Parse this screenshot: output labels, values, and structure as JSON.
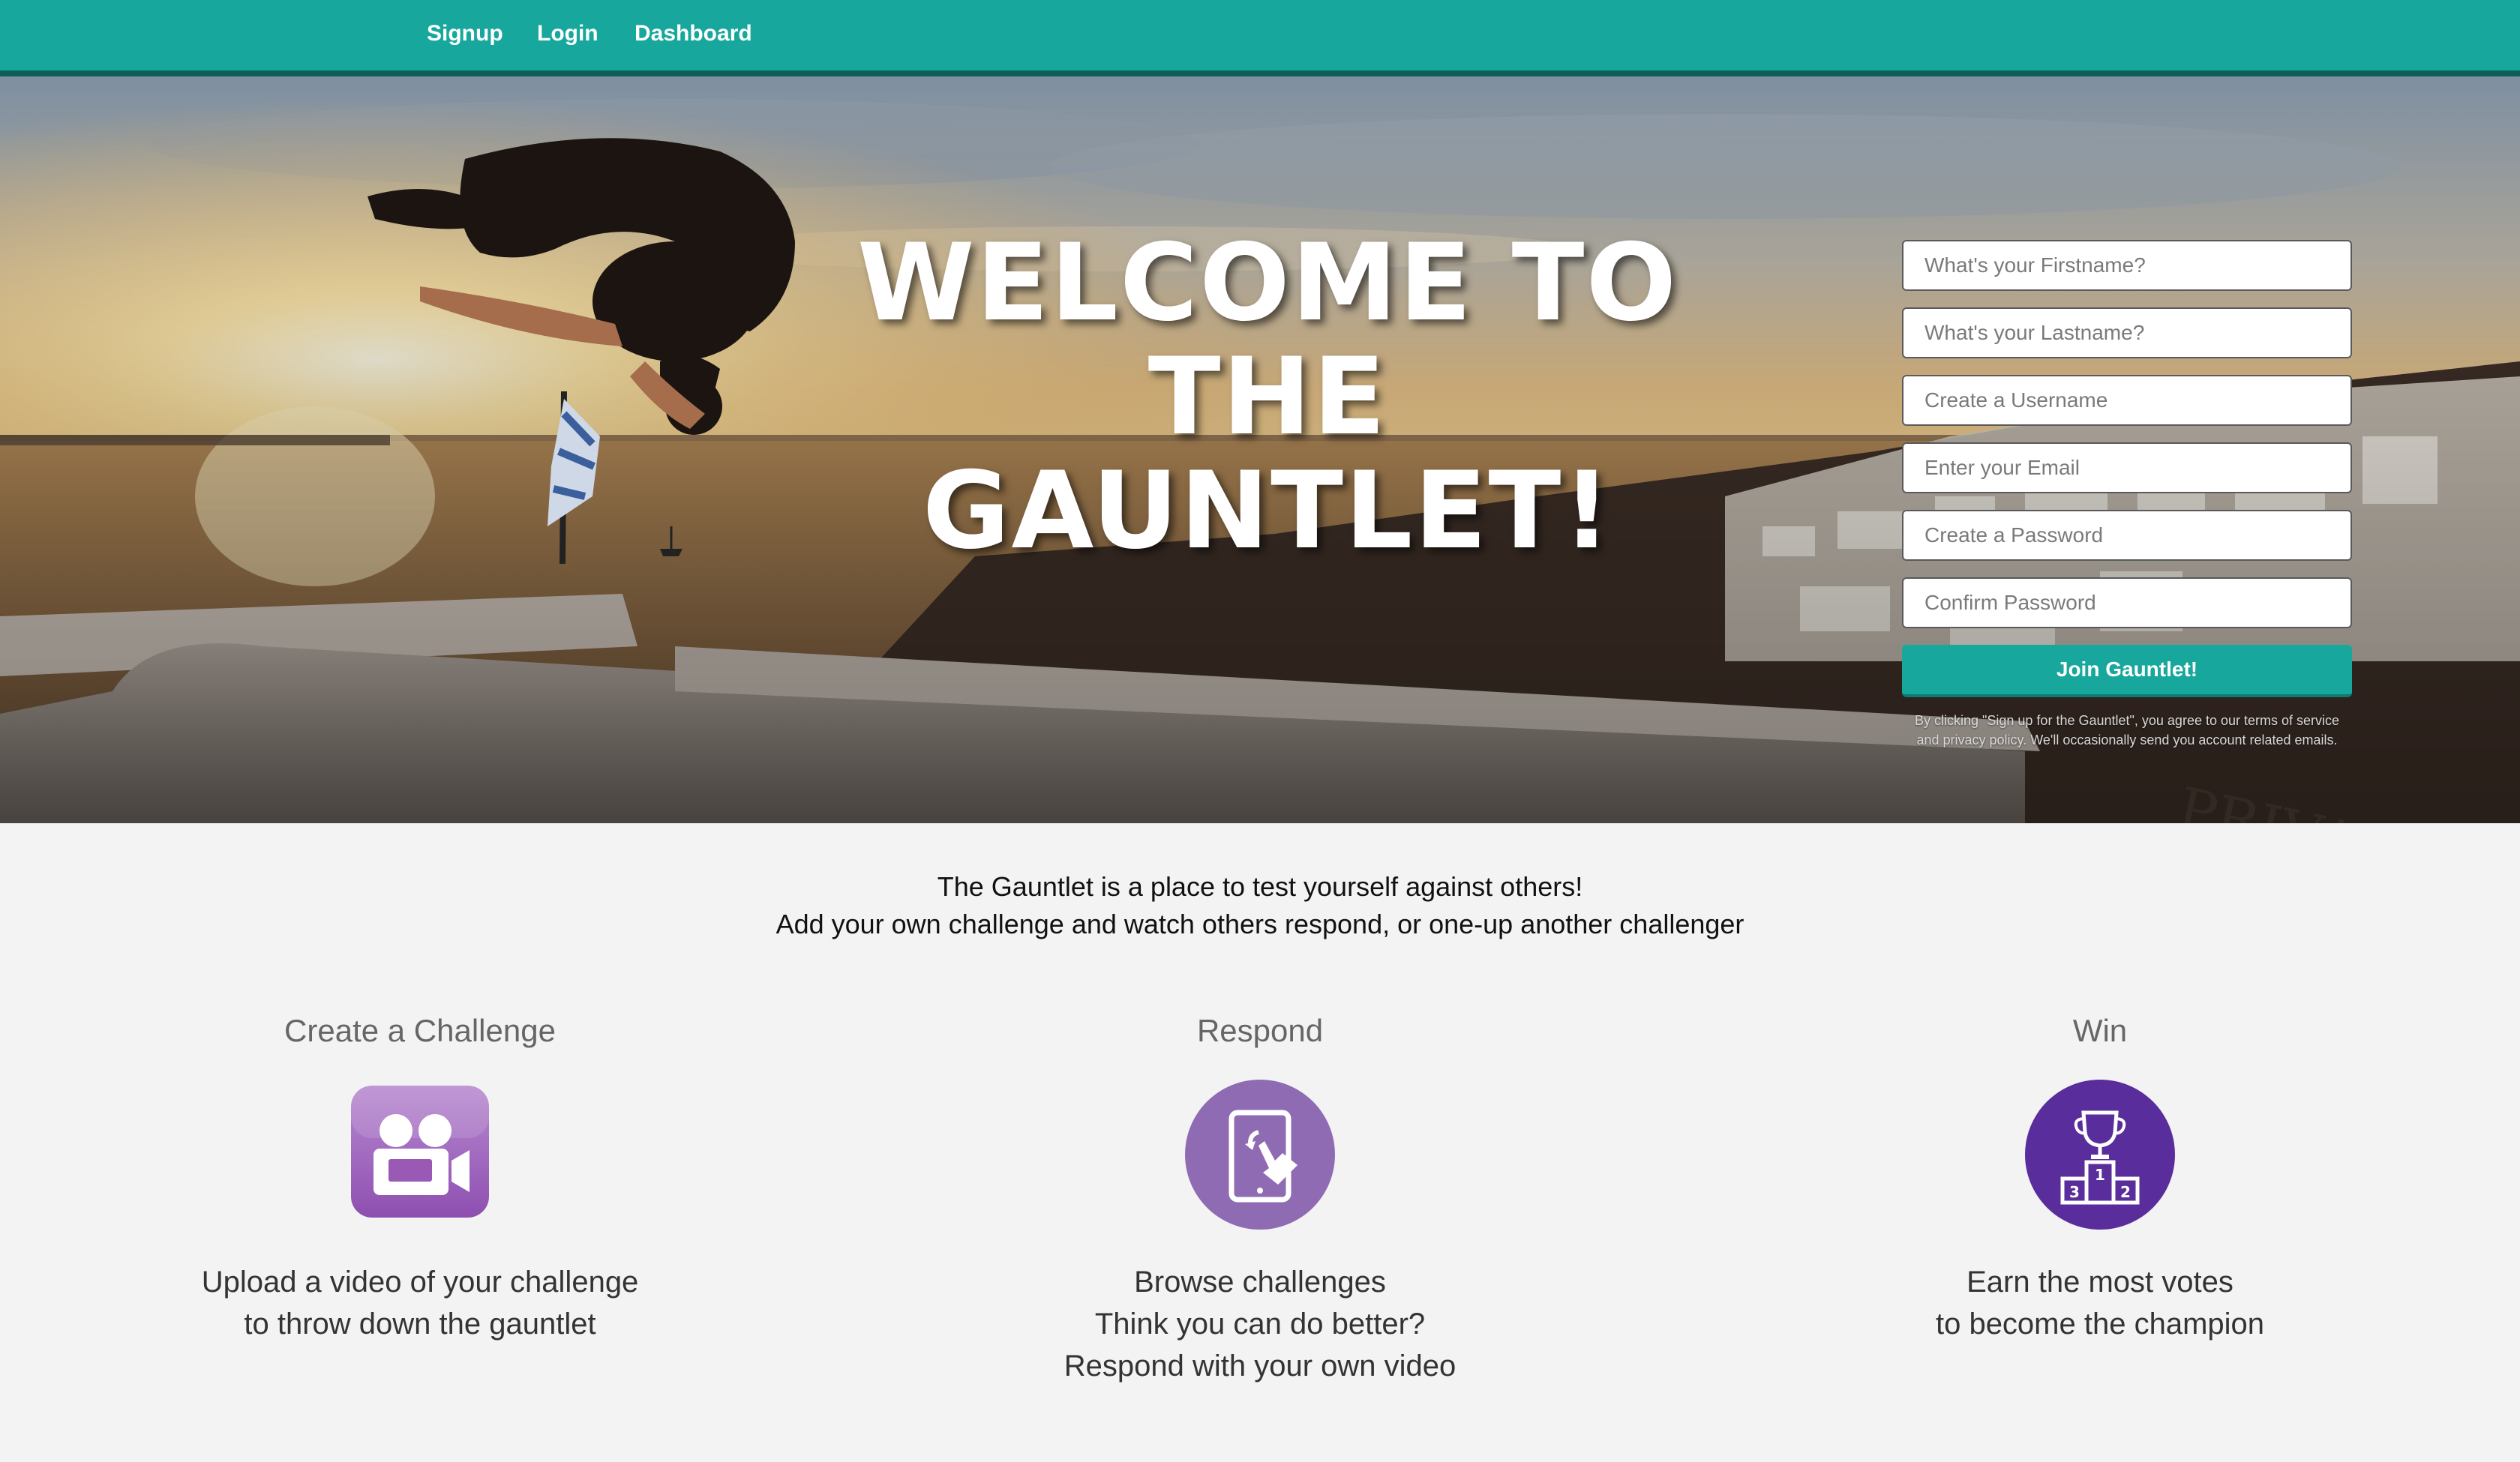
{
  "nav": {
    "links": [
      "Signup",
      "Login",
      "Dashboard"
    ]
  },
  "hero": {
    "title_line1": "WELCOME TO THE",
    "title_line2": "GAUNTLET!",
    "image_text": "PRIVATE"
  },
  "form": {
    "firstname_placeholder": "What's your Firstname?",
    "lastname_placeholder": "What's your Lastname?",
    "username_placeholder": "Create a Username",
    "email_placeholder": "Enter your Email",
    "password_placeholder": "Create a Password",
    "confirm_placeholder": "Confirm Password",
    "submit_label": "Join Gauntlet!",
    "disclaimer": "By clicking \"Sign up for the Gauntlet\", you agree to our terms of service and privacy policy. We'll occasionally send you account related emails."
  },
  "intro": {
    "line1": "The Gauntlet is a place to test yourself against others!",
    "line2": "Add your own challenge and watch others respond, or one-up another challenger"
  },
  "features": [
    {
      "title": "Create a Challenge",
      "icon": "video-camera-icon",
      "lines": [
        "Upload a video of your challenge",
        "to throw down the gauntlet"
      ]
    },
    {
      "title": "Respond",
      "icon": "tablet-touch-icon",
      "lines": [
        "Browse challenges",
        "Think you can do better?",
        "Respond with your own video"
      ]
    },
    {
      "title": "Win",
      "icon": "trophy-podium-icon",
      "podium_numbers": [
        "1",
        "3",
        "2"
      ],
      "lines": [
        "Earn the most votes",
        "to become the champion"
      ]
    }
  ],
  "colors": {
    "accent": "#17a79c",
    "accent_dark": "#0f5d59",
    "challenge_icon": "#9b59b6",
    "respond_icon": "#8f6bb3",
    "win_icon": "#5a2d9c"
  }
}
